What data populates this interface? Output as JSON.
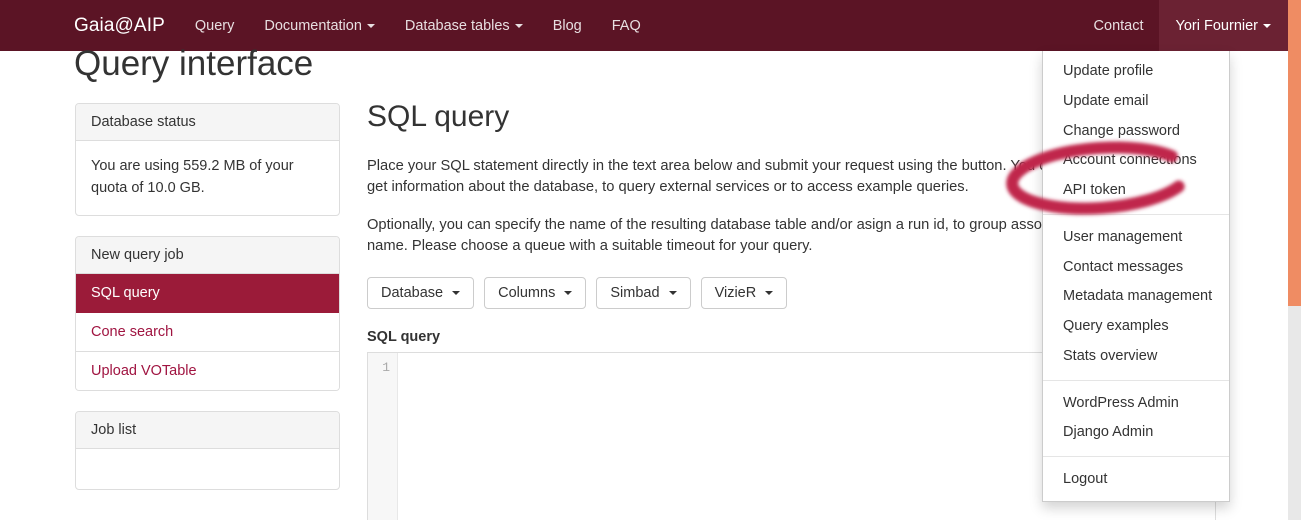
{
  "navbar": {
    "brand": "Gaia@AIP",
    "left_items": [
      {
        "label": "Query",
        "caret": false
      },
      {
        "label": "Documentation",
        "caret": true
      },
      {
        "label": "Database tables",
        "caret": true
      },
      {
        "label": "Blog",
        "caret": false
      },
      {
        "label": "FAQ",
        "caret": false
      }
    ],
    "right_items": [
      {
        "label": "Contact",
        "caret": false
      },
      {
        "label": "Yori Fournier",
        "caret": true,
        "active": true
      }
    ],
    "background_color": "#5b1425",
    "active_background_color": "#6b2233"
  },
  "user_menu": {
    "groups": [
      {
        "items": [
          "Update profile",
          "Update email",
          "Change password",
          "Account connections",
          "API token"
        ]
      },
      {
        "items": [
          "User management",
          "Contact messages",
          "Metadata management",
          "Query examples",
          "Stats overview"
        ]
      },
      {
        "items": [
          "WordPress Admin",
          "Django Admin"
        ]
      },
      {
        "items": [
          "Logout"
        ]
      }
    ]
  },
  "annotation": {
    "name": "red-ellipse-highlight",
    "target": "API token",
    "color": "#c0254b"
  },
  "page": {
    "title": "Query interface"
  },
  "sidebar": {
    "status_panel": {
      "heading": "Database status",
      "body": "You are using 559.2 MB of your quota of 10.0 GB."
    },
    "job_panel": {
      "heading": "New query job",
      "items": [
        {
          "label": "SQL query",
          "active": true
        },
        {
          "label": "Cone search",
          "active": false
        },
        {
          "label": "Upload VOTable",
          "active": false
        }
      ]
    },
    "joblist_panel": {
      "heading": "Job list"
    },
    "active_color": "#9b1b39",
    "link_color": "#a01441"
  },
  "main": {
    "heading": "SQL query",
    "paragraph_1": "Place your SQL statement directly in the text area below and submit your request using the button. You can use the buttons below to get information about the database, to query external services or to access example queries.",
    "paragraph_2": "Optionally, you can specify the name of the resulting database table and/or asign a run id, to group associated jobs under a common name. Please choose a queue with a suitable timeout for your query.",
    "buttons": [
      {
        "label": "Database",
        "caret": true
      },
      {
        "label": "Columns",
        "caret": true
      },
      {
        "label": "Simbad",
        "caret": true
      },
      {
        "label": "VizieR",
        "caret": true
      }
    ],
    "editor_label": "SQL query",
    "editor_line_number": "1",
    "editor_value": ""
  },
  "scrollbar": {
    "thumb_color": "#ef8c63",
    "track_color": "#e8e8e8"
  }
}
